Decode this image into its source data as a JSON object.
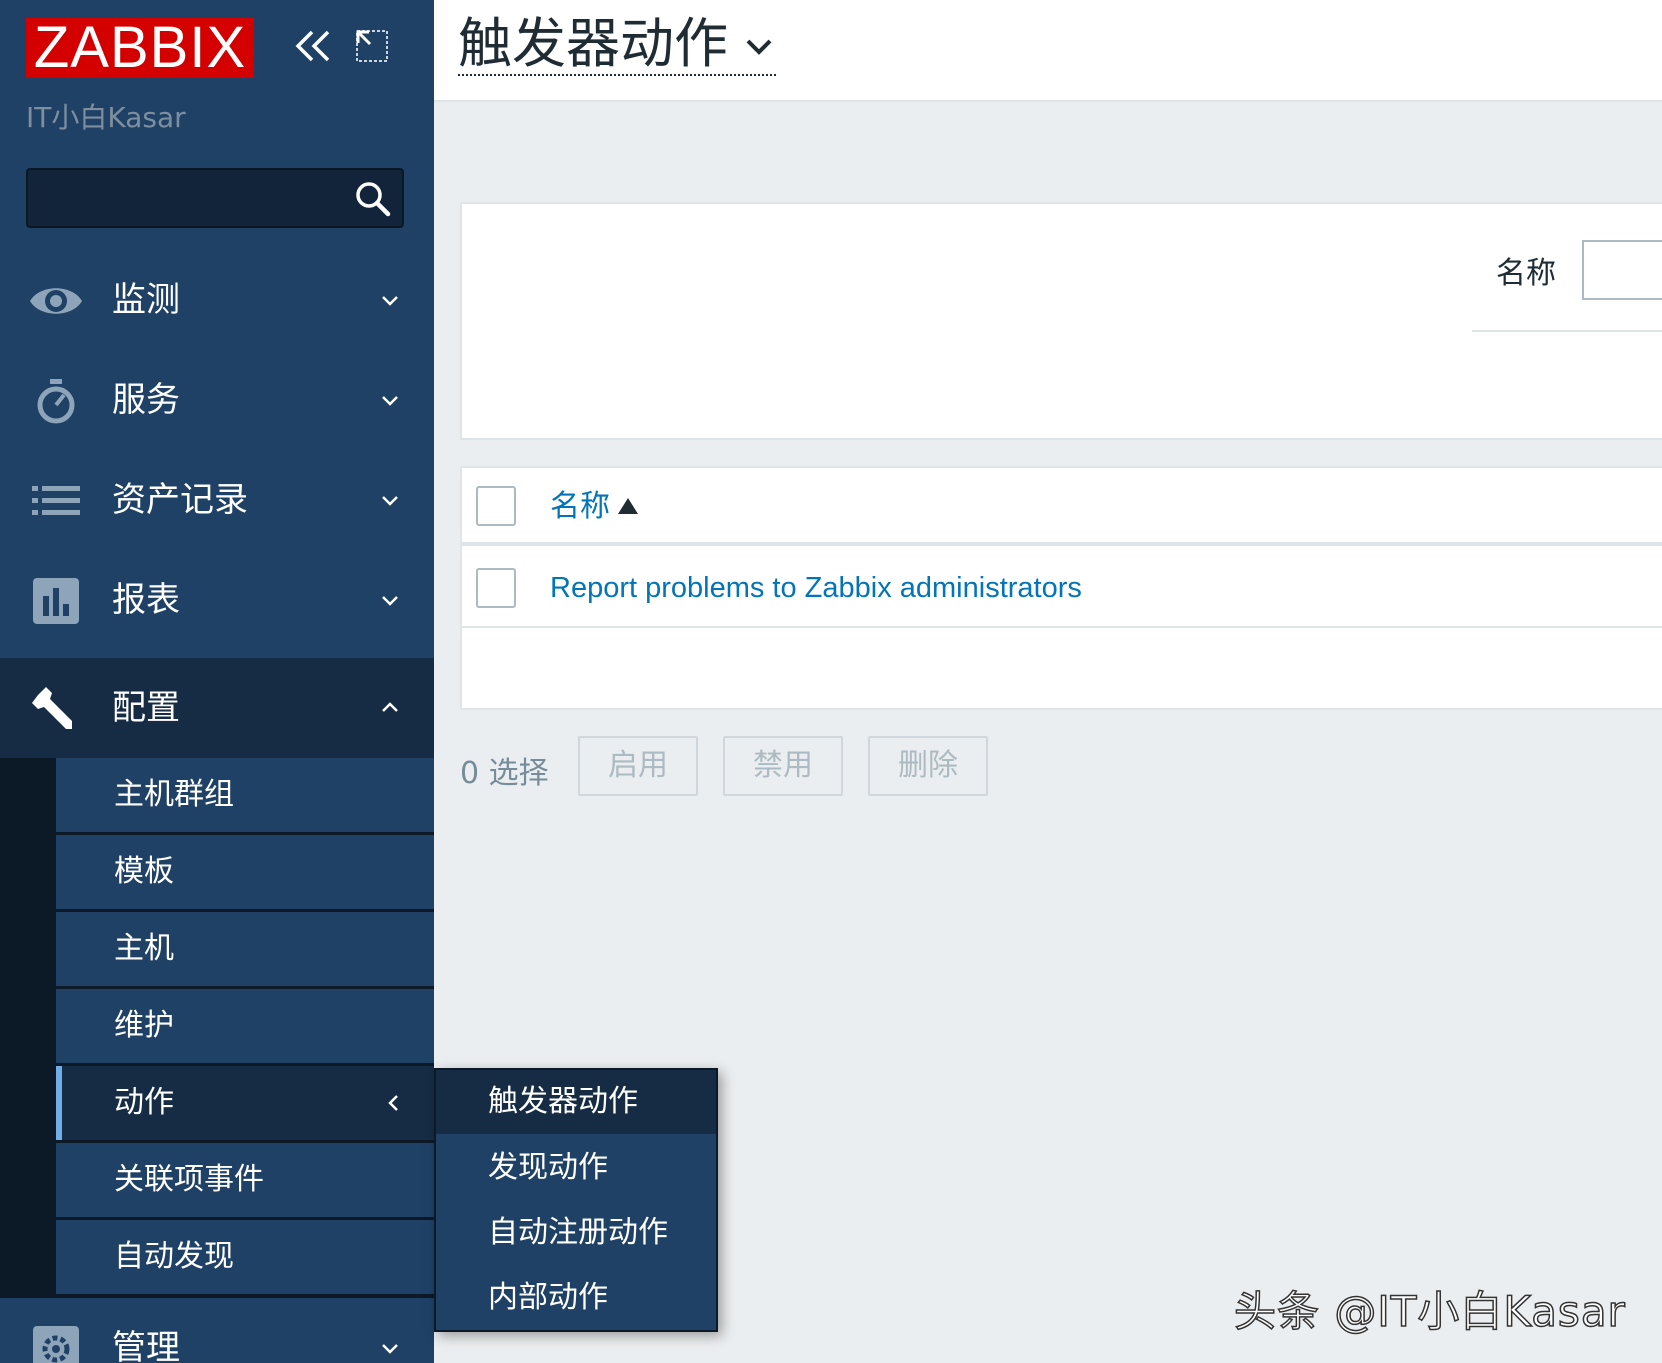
{
  "brand": {
    "logo_text": "ZABBIX",
    "server_name": "IT小白Kasar",
    "logo_color": "#d40000"
  },
  "search": {
    "value": "",
    "placeholder": ""
  },
  "menu": [
    {
      "label": "监测",
      "icon": "eye-icon",
      "expanded": false
    },
    {
      "label": "服务",
      "icon": "stopwatch-icon",
      "expanded": false
    },
    {
      "label": "资产记录",
      "icon": "list-icon",
      "expanded": false
    },
    {
      "label": "报表",
      "icon": "bar-chart-icon",
      "expanded": false
    },
    {
      "label": "配置",
      "icon": "wrench-icon",
      "expanded": true
    },
    {
      "label": "管理",
      "icon": "gear-icon",
      "expanded": false
    }
  ],
  "config_submenu": [
    "主机群组",
    "模板",
    "主机",
    "维护",
    "动作",
    "关联项事件",
    "自动发现"
  ],
  "actions_flyout": [
    "触发器动作",
    "发现动作",
    "自动注册动作",
    "内部动作"
  ],
  "header": {
    "title": "触发器动作"
  },
  "filter": {
    "name_label": "名称",
    "name_value": ""
  },
  "table": {
    "column_name": "名称",
    "rows": [
      {
        "name": "Report problems to Zabbix administrators"
      }
    ]
  },
  "actions_bar": {
    "selected_count": "0 选择",
    "enable": "启用",
    "disable": "禁用",
    "delete": "删除"
  },
  "watermark": "头条 @IT小白Kasar",
  "colors": {
    "sidebar": "#1f4166",
    "sidebar_active": "#152c44",
    "link": "#0275b8",
    "selected_marker": "#71aee7"
  }
}
